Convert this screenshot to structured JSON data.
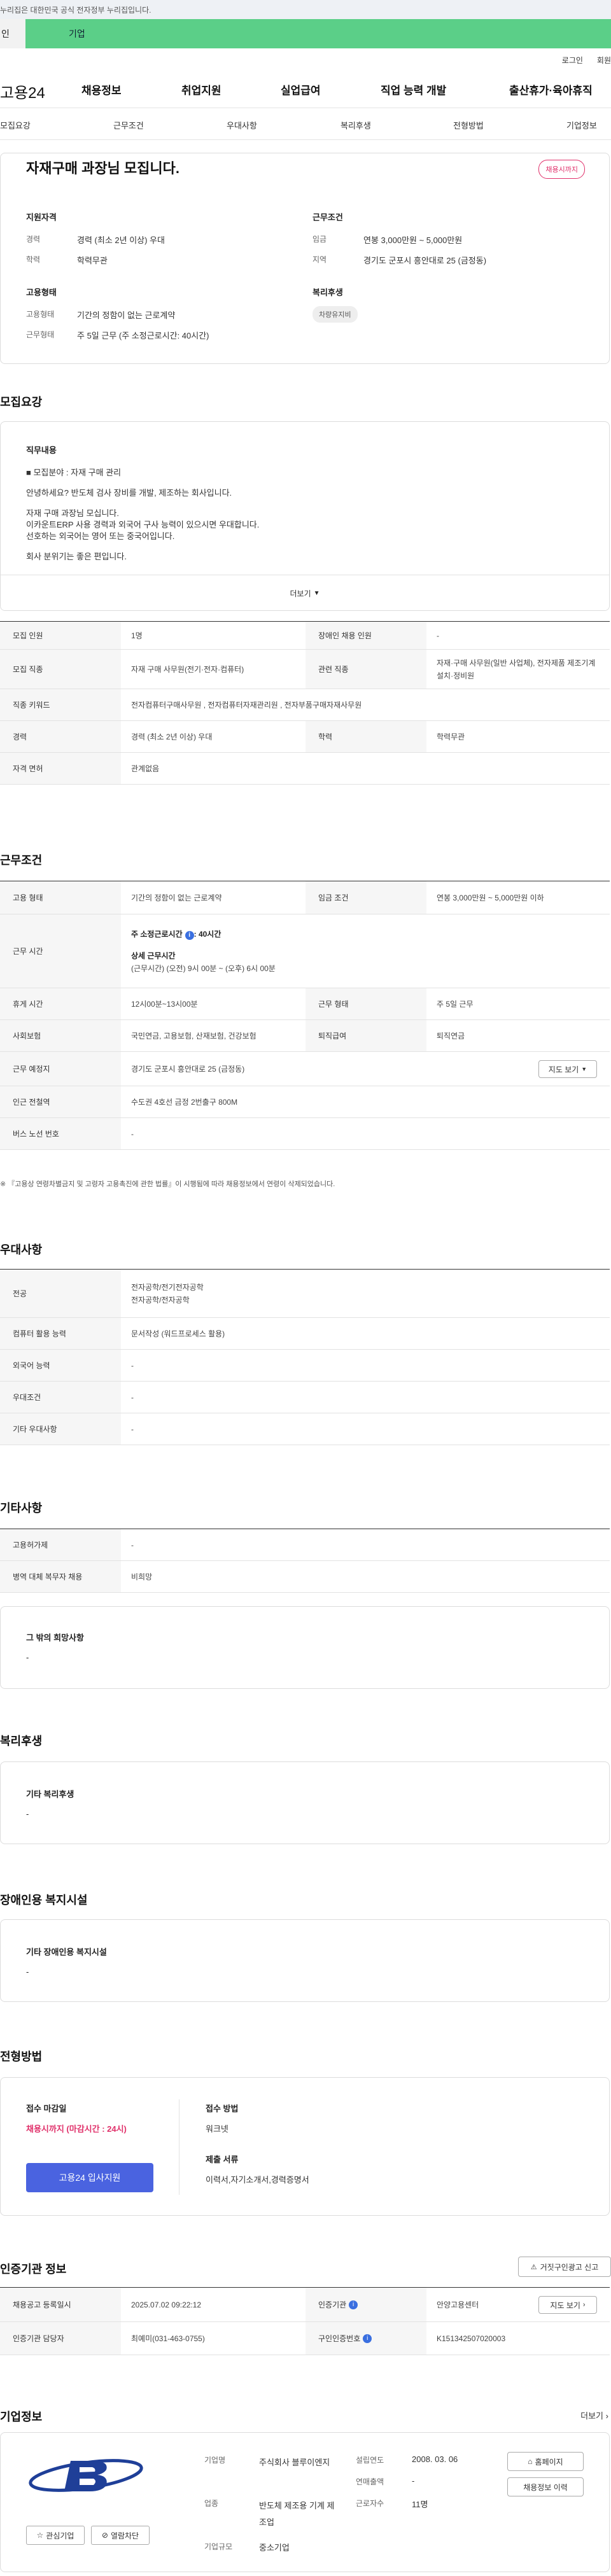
{
  "gov_banner": "이 누리집은 대한민국 공식 전자정부 누리집입니다.",
  "gov_banner_visible": "누리집은 대한민국 공식 전자정부 누리집입니다.",
  "user_tabs": {
    "personal": "인",
    "company": "기업"
  },
  "util": {
    "login": "로그인",
    "join": "회원"
  },
  "logo": "고용24",
  "gnb": [
    "채용정보",
    "취업지원",
    "실업급여",
    "직업 능력 개발",
    "출산휴가·육아휴직"
  ],
  "lnb": [
    "모집요강",
    "근무조건",
    "우대사항",
    "복리후생",
    "전형방법",
    "기업정보"
  ],
  "summary": {
    "title": "자재구매 과장님 모집니다.",
    "badge": "채용시까지",
    "qual_title": "지원자격",
    "career_label": "경력",
    "career": "경력 (최소 2년 이상) 우대",
    "edu_label": "학력",
    "edu": "학력무관",
    "cond_title": "근무조건",
    "wage_label": "임금",
    "wage": "연봉 3,000만원 ~ 5,000만원",
    "area_label": "지역",
    "area": "경기도 군포시 흥안대로 25 (금정동)",
    "emp_title": "고용형태",
    "emptype_label": "고용형태",
    "emptype": "기간의 정함이 없는 근로계약",
    "worktype_label": "근무형태",
    "worktype": "주 5일 근무 (주 소정근로시간: 40시간)",
    "welfare_title": "복리후생",
    "welfare_tag": "차량유지비"
  },
  "recruit": {
    "heading": "모집요강",
    "desc_title": "직무내용",
    "lines": [
      "■ 모집분야 : 자재 구매 관리",
      "안녕하세요? 반도체 검사 장비를 개발, 제조하는 회사입니다.",
      "자재 구매 과장님 모십니다.",
      "이카운트ERP 사용 경력과 외국어 구사 능력이 있으시면 우대합니다.",
      "선호하는 외국어는 영어 또는 중국어입니다.",
      "회사 분위기는 좋은 편입니다."
    ],
    "more": "더보기",
    "rows": [
      {
        "th": "모집 인원",
        "td": "1명",
        "th2": "장애인 채용 인원",
        "td2": "-"
      },
      {
        "th": "모집 직종",
        "td": "자재 구매 사무원(전기·전자·컴퓨터)",
        "th2": "관련 직종",
        "td2": "자재·구매 사무원(일반 사업체), 전자제품 제조기계 설치·정비원"
      },
      {
        "th": "직종 키워드",
        "td": "전자컴퓨터구매사무원 , 전자컴퓨터자재관리원 , 전자부품구매자재사무원"
      },
      {
        "th": "경력",
        "td": "경력 (최소 2년 이상) 우대",
        "th2": "학력",
        "td2": "학력무관"
      },
      {
        "th": "자격 면허",
        "td": "관계없음"
      }
    ]
  },
  "work": {
    "heading": "근무조건",
    "emp_th": "고용 형태",
    "emp_td": "기간의 정함이 없는 근로계약",
    "wage_th": "임금 조건",
    "wage_td": "연봉 3,000만원 ~ 5,000만원 이하",
    "time_th": "근무 시간",
    "time_1": "주 소정근로시간",
    "time_1b": ": 40시간",
    "time_2": "상세 근무시간",
    "time_3": "(근무시간) (오전) 9시 00분 ~ (오후) 6시 00분",
    "rest_th": "휴게 시간",
    "rest_td": "12시00분~13시00분",
    "form_th": "근무 형태",
    "form_td": "주 5일 근무",
    "ins_th": "사회보험",
    "ins_td": "국민연금, 고용보험, 산재보험, 건강보험",
    "ret_th": "퇴직급여",
    "ret_td": "퇴직연금",
    "place_th": "근무 예정지",
    "place_td": "경기도 군포시 흥안대로 25 (금정동)",
    "map_btn": "지도 보기",
    "sub_th": "인근 전철역",
    "sub_td": "수도권 4호선 금정 2번출구 800M",
    "bus_th": "버스 노선 번호",
    "bus_td": "-",
    "note": "※ 『고용상 연령차별금지 및 고령자 고용촉진에 관한 법률』이 시행됨에 따라 채용정보에서 연령이 삭제되었습니다."
  },
  "pref": {
    "heading": "우대사항",
    "rows": [
      {
        "th": "전공",
        "td": [
          "전자공학/전기전자공학",
          "전자공학/전자공학"
        ]
      },
      {
        "th": "컴퓨터 활용 능력",
        "td": [
          "문서작성 (워드프로세스 활용)"
        ]
      },
      {
        "th": "외국어 능력",
        "td": [
          "-"
        ]
      },
      {
        "th": "우대조건",
        "td": [
          "-"
        ]
      },
      {
        "th": "기타 우대사항",
        "td": [
          "-"
        ]
      }
    ]
  },
  "etc": {
    "heading": "기타사항",
    "rows": [
      {
        "th": "고용허가제",
        "td": "-"
      },
      {
        "th": "병역 대체 복무자 채용",
        "td": "비희망"
      }
    ],
    "other_title": "그 밖의 희망사항",
    "other_val": "-"
  },
  "welfare": {
    "heading": "복리후생",
    "title": "기타 복리후생",
    "val": "-"
  },
  "disab": {
    "heading": "장애인용 복지시설",
    "title": "기타 장애인용 복지시설",
    "val": "-"
  },
  "process": {
    "heading": "전형방법",
    "deadline_label": "접수 마감일",
    "deadline": "채용시까지 (마감시간 : 24시)",
    "apply_btn": "고용24 입사지원",
    "method_label": "접수 방법",
    "method": "워크넷",
    "docs_label": "제출 서류",
    "docs": "이력서,자기소개서,경력증명서"
  },
  "cert": {
    "heading": "인증기관 정보",
    "report_btn": "거짓구인광고 신고",
    "reg_th": "채용공고 등록일시",
    "reg_td": "2025.07.02 09:22:12",
    "org_th": "인증기관",
    "org_td": "안양고용센터",
    "map_btn": "지도 보기",
    "mgr_th": "인증기관 담당자",
    "mgr_td": "최예미(031-463-0755)",
    "no_th": "구인인증번호",
    "no_td": "K151342507020003"
  },
  "company": {
    "heading": "기업정보",
    "more": "더보기",
    "name_label": "기업명",
    "name": "주식회사 블루이엔지",
    "industry_label": "업종",
    "industry": "반도체 제조용 기계 제조업",
    "size_label": "기업규모",
    "size": "중소기업",
    "founded_label": "설립연도",
    "founded": "2008. 03. 06",
    "sales_label": "연매출액",
    "sales": "-",
    "emp_label": "근로자수",
    "emp": "11명",
    "fav_btn": "관심기업",
    "block_btn": "열람차단",
    "home_btn": "홈페이지",
    "jobs_btn": "채용정보 이력"
  }
}
